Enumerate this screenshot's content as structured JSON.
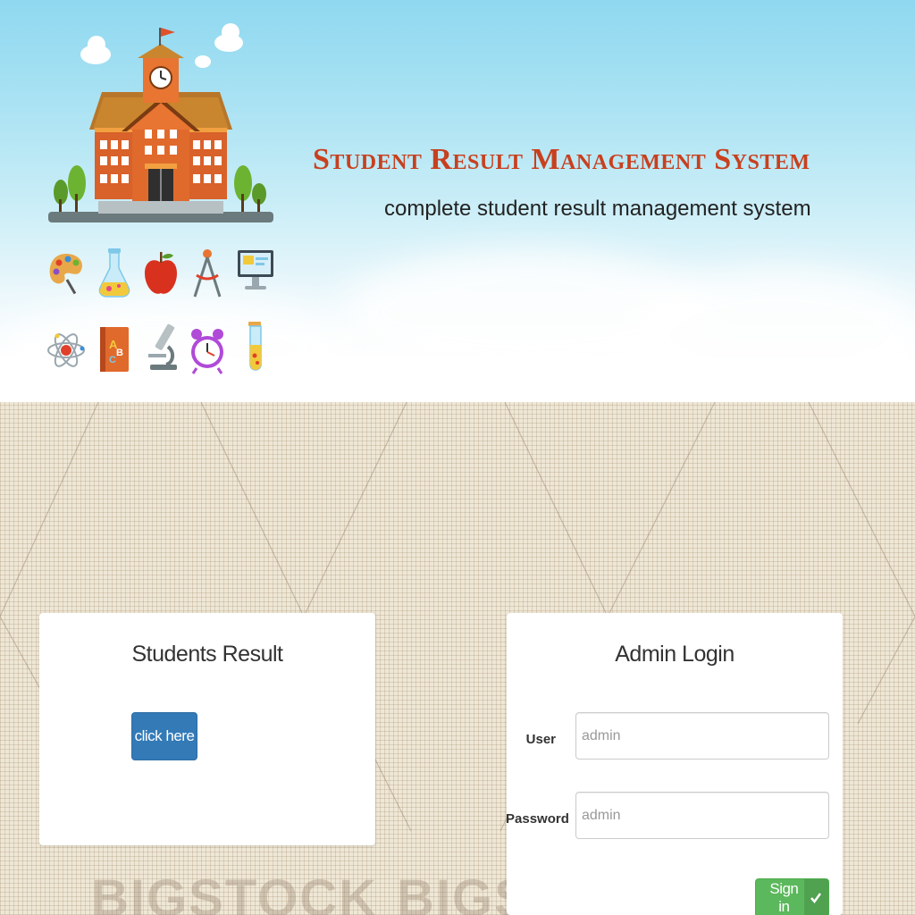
{
  "header": {
    "title": "Student Result Management System",
    "subtitle": "complete student result management system",
    "title_color": "#c8401e"
  },
  "icons": [
    "palette-icon",
    "flask-icon",
    "apple-icon",
    "compass-icon",
    "monitor-icon",
    "atom-icon",
    "abc-book-icon",
    "microscope-icon",
    "alarm-clock-icon",
    "test-tube-icon"
  ],
  "watermark": "BIGSTOCK",
  "students_card": {
    "title": "Students Result",
    "button_label": "click here",
    "button_color": "#337ab7"
  },
  "admin_card": {
    "title": "Admin Login",
    "user_label": "User",
    "user_placeholder": "admin",
    "password_label": "Password",
    "password_placeholder": "admin",
    "signin_label": "Sign in",
    "signin_color": "#5cb85c"
  }
}
